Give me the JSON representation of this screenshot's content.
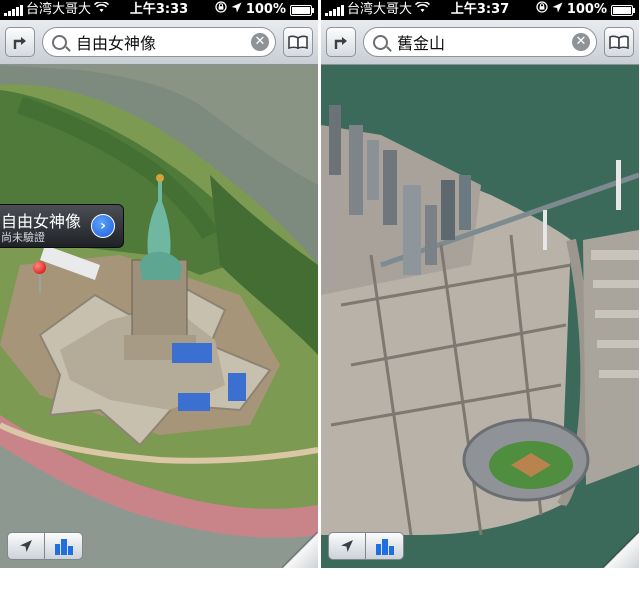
{
  "screens": [
    {
      "status": {
        "carrier": "台湾大哥大",
        "time": "上午3:33",
        "battery": "100%"
      },
      "search": {
        "query": "自由女神像"
      },
      "callout": {
        "title": "自由女神像",
        "subtitle": "尚未驗證"
      }
    },
    {
      "status": {
        "carrier": "台湾大哥大",
        "time": "上午3:37",
        "battery": "100%"
      },
      "search": {
        "query": "舊金山"
      }
    }
  ],
  "icons": {
    "directions": "directions-arrow-icon",
    "bookmarks": "bookmarks-book-icon",
    "clear": "clear-x-icon",
    "locate": "location-arrow-icon",
    "flyover": "3d-buildings-icon"
  },
  "colors": {
    "pin": "#d10000",
    "callout_accent": "#1d5fd6",
    "water_left": "#7a8578",
    "water_right": "#3c6a5a"
  }
}
